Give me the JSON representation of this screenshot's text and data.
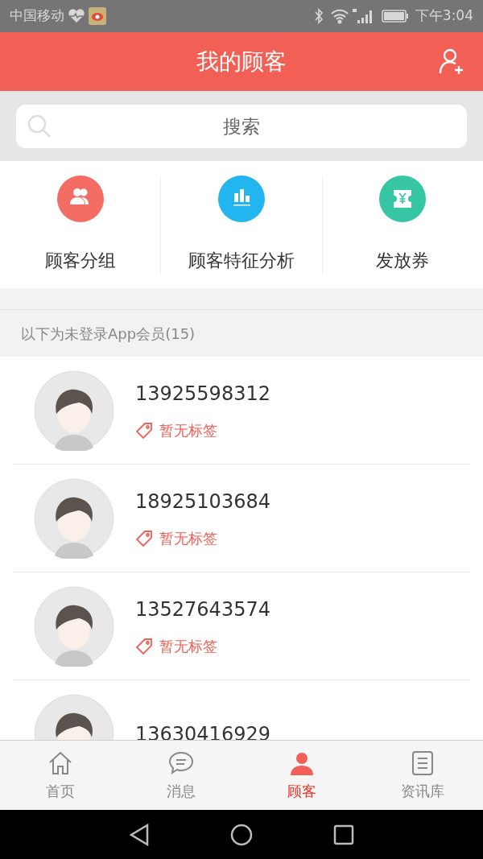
{
  "status_bar": {
    "carrier": "中国移动",
    "time": "下午3:04"
  },
  "header": {
    "title": "我的顾客"
  },
  "search": {
    "placeholder": "搜索"
  },
  "features": [
    {
      "kind": "group",
      "label": "顾客分组",
      "color": "#f46d65"
    },
    {
      "kind": "analysis",
      "label": "顾客特征分析",
      "color": "#23b5ef"
    },
    {
      "kind": "coupon",
      "label": "发放券",
      "color": "#36c6a3"
    }
  ],
  "section_label": "以下为未登录App会员(15)",
  "customers": [
    {
      "phone": "13925598312",
      "tag": "暂无标签"
    },
    {
      "phone": "18925103684",
      "tag": "暂无标签"
    },
    {
      "phone": "13527643574",
      "tag": "暂无标签"
    },
    {
      "phone": "13630416929"
    }
  ],
  "tabs": [
    {
      "kind": "home",
      "label": "首页",
      "selected": false
    },
    {
      "kind": "message",
      "label": "消息",
      "selected": false
    },
    {
      "kind": "customer",
      "label": "顾客",
      "selected": true
    },
    {
      "kind": "library",
      "label": "资讯库",
      "selected": false
    }
  ]
}
